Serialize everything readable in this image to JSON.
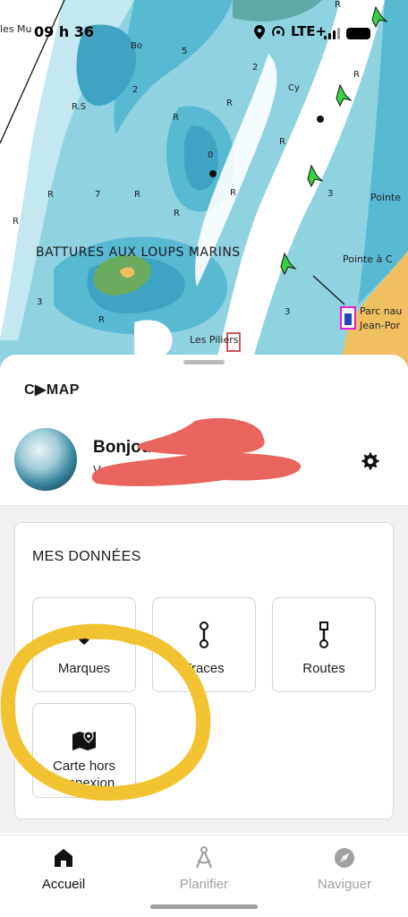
{
  "status_bar": {
    "time": "09 h 36",
    "network": "LTE+"
  },
  "map": {
    "area_label": "BATTURES AUX LOUPS MARINS",
    "place_labels": [
      "les Mu",
      "Pointe",
      "Pointe à C",
      "Parc nau",
      "Jean-Por",
      "Les Piliers"
    ],
    "depth_labels": [
      "5",
      "2",
      "Bo",
      "2",
      "Cy",
      "0",
      "7",
      "3",
      "3",
      "3",
      "R.S"
    ],
    "rock_marker": "R",
    "colors": {
      "deep": "#8fd3e0",
      "mid": "#58b9d3",
      "shallow": "#c3e8ef",
      "land": "#f0c060",
      "islet": "#6bab5e",
      "white_bank": "#ffffff"
    }
  },
  "sheet": {
    "brand": "C▶MAP",
    "greeting": "Bonjour D",
    "sub_greeting": "V",
    "settings_icon": "gear-icon",
    "section_title": "MES DONNÉES",
    "tiles": [
      {
        "label": "Marques",
        "icon": "marker-icon"
      },
      {
        "label": "Traces",
        "icon": "track-icon"
      },
      {
        "label": "Routes",
        "icon": "route-icon"
      },
      {
        "label": "Carte hors connexion",
        "icon": "offline-map-icon"
      }
    ]
  },
  "nav": {
    "items": [
      {
        "label": "Accueil",
        "icon": "home-icon",
        "active": true
      },
      {
        "label": "Planifier",
        "icon": "compass-icon",
        "active": false
      },
      {
        "label": "Naviguer",
        "icon": "navigate-icon",
        "active": false
      }
    ],
    "active_color": "#111111",
    "inactive_color": "#a0a0a0"
  },
  "annotation": {
    "highlight_color": "#f2c230",
    "redaction_color": "#e8655d"
  }
}
